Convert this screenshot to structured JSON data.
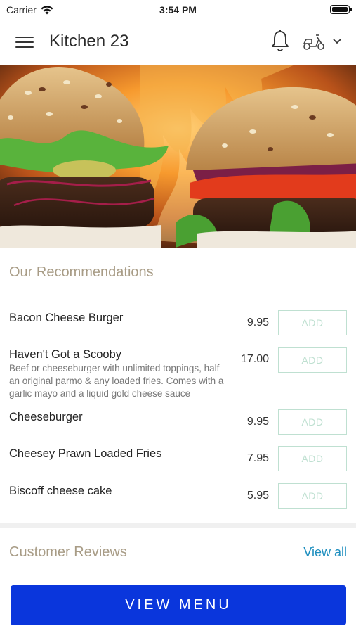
{
  "status_bar": {
    "carrier": "Carrier",
    "time": "3:54 PM"
  },
  "header": {
    "title": "Kitchen 23",
    "icons": [
      "menu-icon",
      "bell-icon",
      "delivery-scooter-icon",
      "chevron-down-icon"
    ]
  },
  "recommendations": {
    "title": "Our Recommendations",
    "add_label": "ADD",
    "items": [
      {
        "name": "Bacon Cheese Burger",
        "price": "9.95",
        "description": ""
      },
      {
        "name": "Haven't Got a Scooby",
        "price": "17.00",
        "description_lines": [
          "Beef or cheeseburger with unlimited toppings, half",
          "an original parmo & any loaded fries. Comes with a",
          "garlic mayo and a liquid gold cheese sauce"
        ]
      },
      {
        "name": "Cheeseburger",
        "price": "9.95",
        "description": ""
      },
      {
        "name": "Cheesey Prawn Loaded Fries",
        "price": "7.95",
        "description": ""
      },
      {
        "name": "Biscoff cheese cake",
        "price": "5.95",
        "description": ""
      }
    ]
  },
  "reviews": {
    "title": "Customer Reviews",
    "view_all": "View all"
  },
  "footer": {
    "view_menu": "VIEW MENU"
  },
  "colors": {
    "accent_button": "#0a36dc",
    "add_border": "#bfe0d1",
    "section_title": "#a89c86",
    "link": "#1f8fbf"
  }
}
